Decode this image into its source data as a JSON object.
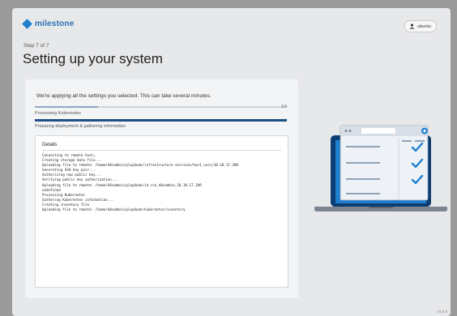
{
  "brand": {
    "name": "milestone",
    "color": "#1f7fcf"
  },
  "user": {
    "name": "ubuntu",
    "icon": "user-icon"
  },
  "step": {
    "label": "Step 7 of 7"
  },
  "page": {
    "title": "Setting up your system"
  },
  "progress": {
    "intro": "We're applying all the settings you selected. This can take several minutes.",
    "count": "1/4",
    "current_task": "Processing Kubernetes",
    "current_step": "Preparing deployment & gathering information",
    "overall_fraction": 0.25,
    "task_fraction": 1.0
  },
  "details": {
    "header": "Details",
    "log": [
      "Connecting to remote host…",
      "Creating storage data file...",
      "Uploading file to remote: /home/k8sadmin/playbook/infrastructure-services/host_vars/10.10.17.209",
      "Generating SSH key pair...",
      "Authorizing new public key...",
      "Verifying public key authorization...",
      "Uploading file to remote: /home/k8sadmin/playbook/id_rsa_k8sadmin_10.10.17.209",
      "undefined",
      "Processing Kubernetes",
      "Gathering Kubernetes information...",
      "Creating inventory file",
      "Uploading file to remote: /home/k8sadmin/playbook/kubernetes/inventory"
    ]
  },
  "illustration": {
    "icon": "laptop-checklist-illustration"
  },
  "footer": {
    "version": "v1.0.0"
  }
}
